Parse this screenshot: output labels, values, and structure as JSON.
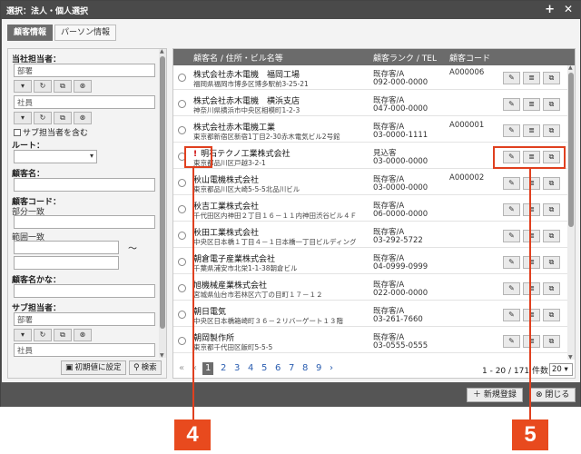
{
  "window": {
    "title": "選択：法人・個人選択",
    "plus_label": "+",
    "close_label": "✕"
  },
  "tabs": [
    {
      "label": "顧客情報"
    },
    {
      "label": "パーソン情報"
    }
  ],
  "left": {
    "own_staff_label": "当社担当者：",
    "dept_value": "部署",
    "staff_value": "社員",
    "sub_include_label": "サブ担当者を含む",
    "route_label": "ルート：",
    "customer_name_label": "顧客名：",
    "customer_code_label": "顧客コード：",
    "partial_label": "部分一致",
    "range_label": "範囲一致",
    "tilde": "〜",
    "kana_label": "顧客名かな：",
    "sub_staff_label": "サブ担当者：",
    "sub_dept_value": "部署",
    "sub_staff_value": "社員",
    "reset_label": "初期値に設定",
    "search_label": "検索"
  },
  "table": {
    "headers": {
      "name_addr": "顧客名 / 住所・ビル名等",
      "rank_tel": "顧客ランク / TEL",
      "code": "顧客コード"
    },
    "rows": [
      {
        "name": "株式会社赤木電機　福岡工場",
        "addr": "福岡県福岡市博多区博多駅前3-25-21",
        "rank": "既存客/A",
        "tel": "092-000-0000",
        "code": "A000006"
      },
      {
        "name": "株式会社赤木電機　横浜支店",
        "addr": "神奈川県横浜市中央区相模町1-2-3",
        "rank": "既存客/A",
        "tel": "047-000-0000",
        "code": ""
      },
      {
        "name": "株式会社赤木電機工業",
        "addr": "東京都新宿区新宿1丁目2-30赤木電気ビル2号館",
        "rank": "既存客/A",
        "tel": "03-0000-1111",
        "code": "A000001"
      },
      {
        "name": "明石テクノ工業株式会社",
        "addr": "東京都品川区戸越3-2-1",
        "rank": "見込客",
        "tel": "03-0000-0000",
        "code": "",
        "flag": "!"
      },
      {
        "name": "秋山電機株式会社",
        "addr": "東京都品川区大崎5-5-5北品川ビル",
        "rank": "既存客/A",
        "tel": "03-0000-0000",
        "code": "A000002"
      },
      {
        "name": "秋吉工業株式会社",
        "addr": "千代田区内神田２丁目１６－１１内神田渋谷ビル４Ｆ",
        "rank": "既存客/A",
        "tel": "06-0000-0000",
        "code": ""
      },
      {
        "name": "秋田工業株式会社",
        "addr": "中央区日本橋１丁目４－１日本橋一丁目ビルディング",
        "rank": "既存客/A",
        "tel": "03-292-5722",
        "code": ""
      },
      {
        "name": "朝倉電子産業株式会社",
        "addr": "千葉県浦安市北栄1-1-38朝倉ビル",
        "rank": "既存客/A",
        "tel": "04-0999-0999",
        "code": ""
      },
      {
        "name": "旭機械産業株式会社",
        "addr": "宮城県仙台市若林区六丁の目町１７－１２",
        "rank": "既存客/A",
        "tel": "022-000-0000",
        "code": ""
      },
      {
        "name": "朝日電気",
        "addr": "中央区日本橋箱崎町３６－２リバーゲート１３階",
        "rank": "既存客/A",
        "tel": "03-261-7660",
        "code": ""
      },
      {
        "name": "朝岡製作所",
        "addr": "東京都千代田区飯町5-5-5",
        "rank": "既存客/A",
        "tel": "03-0555-0555",
        "code": ""
      }
    ]
  },
  "pager": {
    "first": "«",
    "prev": "‹",
    "pages": [
      "1",
      "2",
      "3",
      "4",
      "5",
      "6",
      "7",
      "8",
      "9"
    ],
    "current": "1",
    "next": "›",
    "range": "1 - 20 / 171 件数 :",
    "per_page": "20"
  },
  "bottom": {
    "new_label": "新規登録",
    "close_label": "閉じる"
  },
  "callouts": {
    "four": "4",
    "five": "5"
  },
  "colors": {
    "accent": "#e84a1e",
    "header": "#6b6b6b",
    "link": "#2a5db0"
  }
}
